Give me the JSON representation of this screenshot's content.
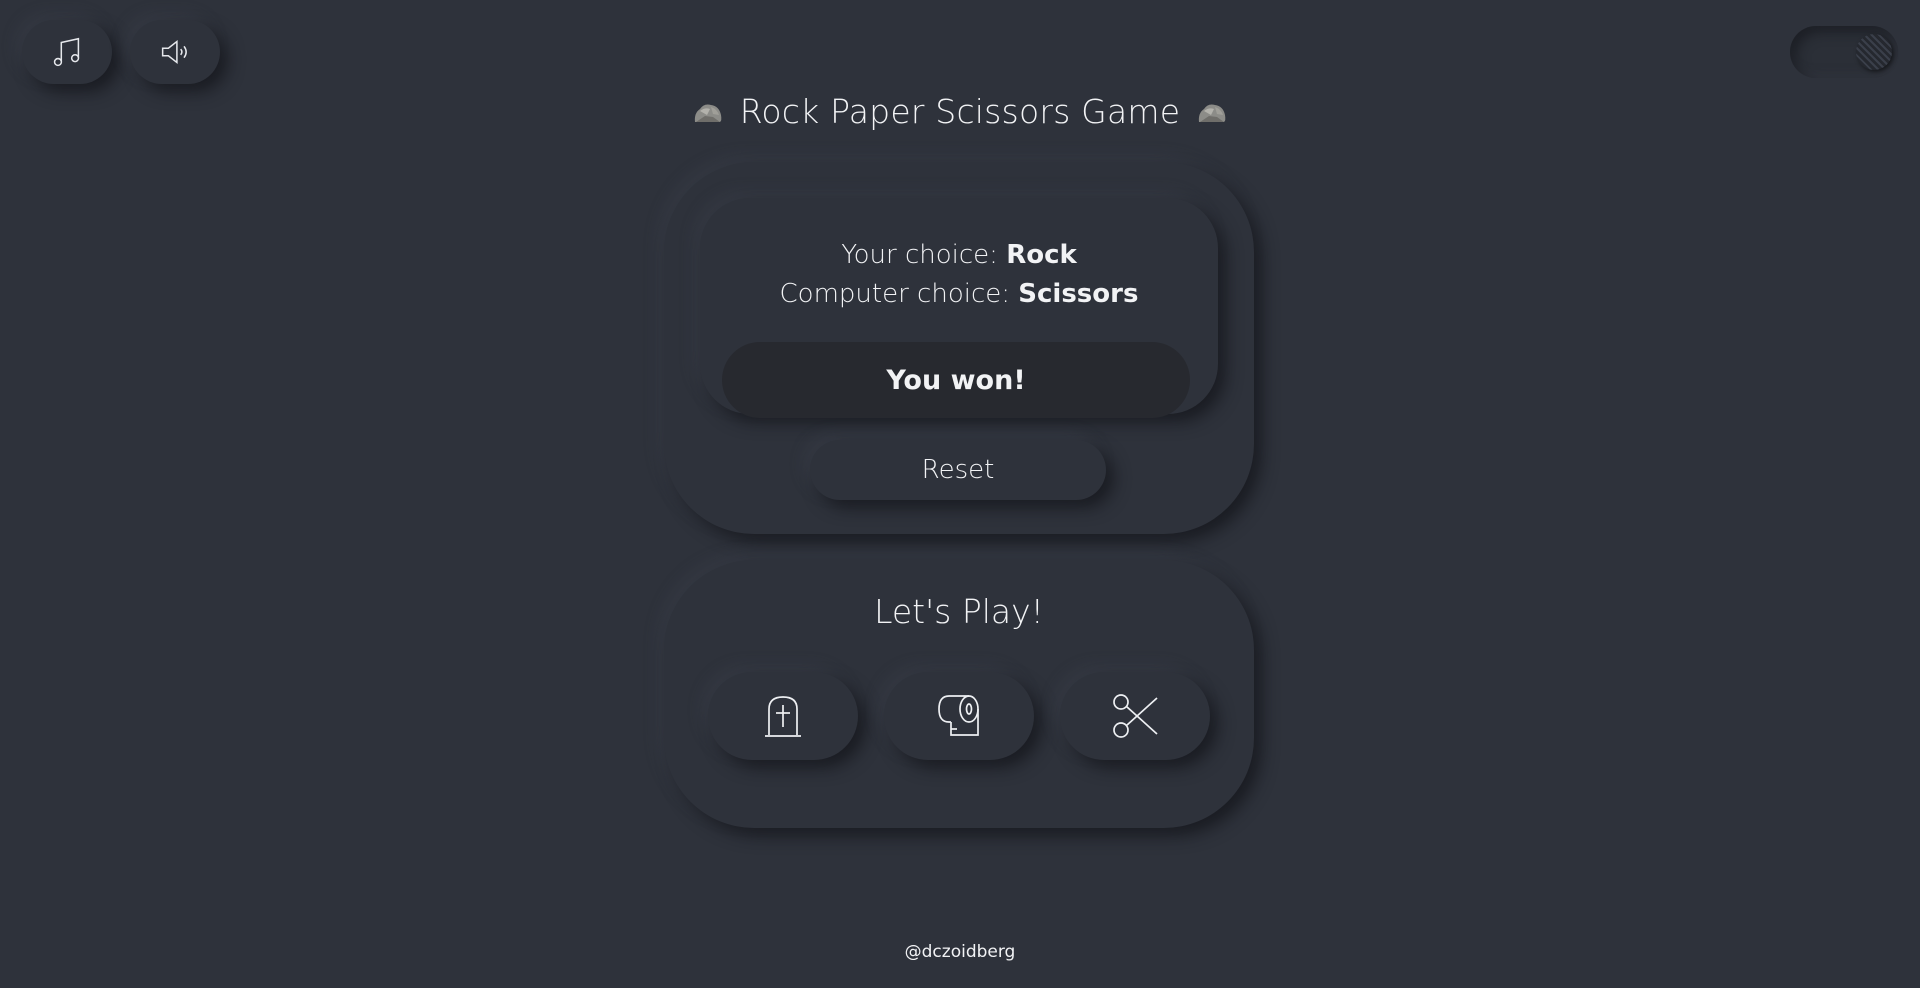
{
  "header": {
    "title": "Rock Paper Scissors Game",
    "title_emoji": "rock-emoji",
    "music_icon": "music-note-icon",
    "sound_icon": "speaker-icon",
    "theme_toggle_icon": "theme-toggle"
  },
  "result": {
    "your_choice_label": "Your choice:",
    "your_choice_value": "Rock",
    "computer_choice_label": "Computer choice:",
    "computer_choice_value": "Scissors",
    "outcome": "You won!",
    "reset_label": "Reset"
  },
  "play": {
    "heading": "Let's Play!",
    "choices": [
      {
        "name": "Rock",
        "icon": "tombstone-icon"
      },
      {
        "name": "Paper",
        "icon": "toilet-paper-icon"
      },
      {
        "name": "Scissors",
        "icon": "scissors-icon"
      }
    ]
  },
  "footer": {
    "credit": "@dczoidberg"
  },
  "colors": {
    "background": "#2e323b",
    "text": "#f2f3f5",
    "outcome_bg": "#27292f"
  }
}
